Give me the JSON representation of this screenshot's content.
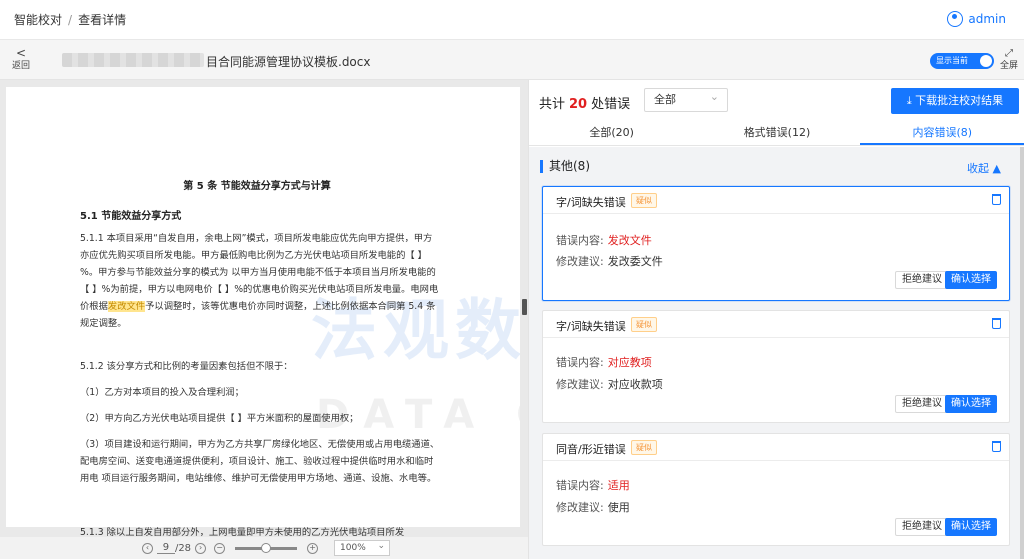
{
  "header": {
    "breadcrumb_root": "智能校对",
    "breadcrumb_sep": "/",
    "breadcrumb_current": "查看详情",
    "user_name": "admin"
  },
  "toolbar": {
    "back_label": "返回",
    "file_name": "目合同能源管理协议模板.docx",
    "toggle_label": "显示当前",
    "fullscreen_label": "全屏"
  },
  "document": {
    "title": "第 5 条 节能效益分享方式与计算",
    "section": "5.1 节能效益分享方式",
    "p1_before": "5.1.1 本项目采用“自发自用，余电上网”模式，项目所发电能应优先向甲方提供，甲方亦应优先购买项目所发电能。甲方最低购电比例为乙方光伏电站项目所发电能的【 】%。甲方参与节能效益分享的模式为 以甲方当月使用电能不低于本项目当月所发电能的【 】%为前提，甲方以电网电价【 】%的优惠电价购买光伏电站项目所发电量。电网电价根据",
    "p1_highlight": "发改文件",
    "p1_after": "予以调整时，该等优惠电价亦同时调整，上述比例依据本合同第 5.4 条规定调整。",
    "p2": "5.1.2 该分享方式和比例的考量因素包括但不限于：",
    "p3": "（1）乙方对本项目的投入及合理利润；",
    "p4": "（2）甲方向乙方光伏电站项目提供【 】平方米面积的屋面使用权；",
    "p5": "（3）项目建设和运行期间，甲方为乙方共享厂房绿化地区、无偿使用或占用电缆通道、配电房空间、送变电通道提供便利，项目设计、施工、验收过程中提供临时用水和临时用电 项目运行服务期间，电站维修、维护可无偿使用甲方场地、通道、设施、水电等。",
    "p6": "5.1.3 除以上自发自用部分外，上网电量即甲方未使用的乙方光伏电站项目所发"
  },
  "pager": {
    "current_page": "9",
    "total_pages": "/28",
    "zoom": "100%"
  },
  "watermark": {
    "main": "法观数据",
    "sub": "DATA GRAND"
  },
  "panel": {
    "summary_prefix": "共计",
    "error_count": "20",
    "summary_suffix": "处错误",
    "filter_value": "全部",
    "download_label": "下载批注校对结果",
    "tabs": [
      "全部(20)",
      "格式错误(12)",
      "内容错误(8)"
    ],
    "group_title": "其他(8)",
    "collapse_label": "收起 ▲",
    "error_content_label": "错误内容:",
    "suggestion_label": "修改建议:",
    "reject_label": "拒绝建议",
    "confirm_label": "确认选择",
    "cards": [
      {
        "type": "字/词缺失错误",
        "tag": "疑似",
        "error": "发改文件",
        "suggestion": "发改委文件"
      },
      {
        "type": "字/词缺失错误",
        "tag": "疑似",
        "error": "对应教项",
        "suggestion": "对应收款项"
      },
      {
        "type": "同音/形近错误",
        "tag": "疑似",
        "error": "适用",
        "suggestion": "使用"
      }
    ]
  },
  "colors": {
    "accent": "#1677ff",
    "error": "#e02020",
    "tag": "#f5963a",
    "highlight": "#ffe58f"
  }
}
